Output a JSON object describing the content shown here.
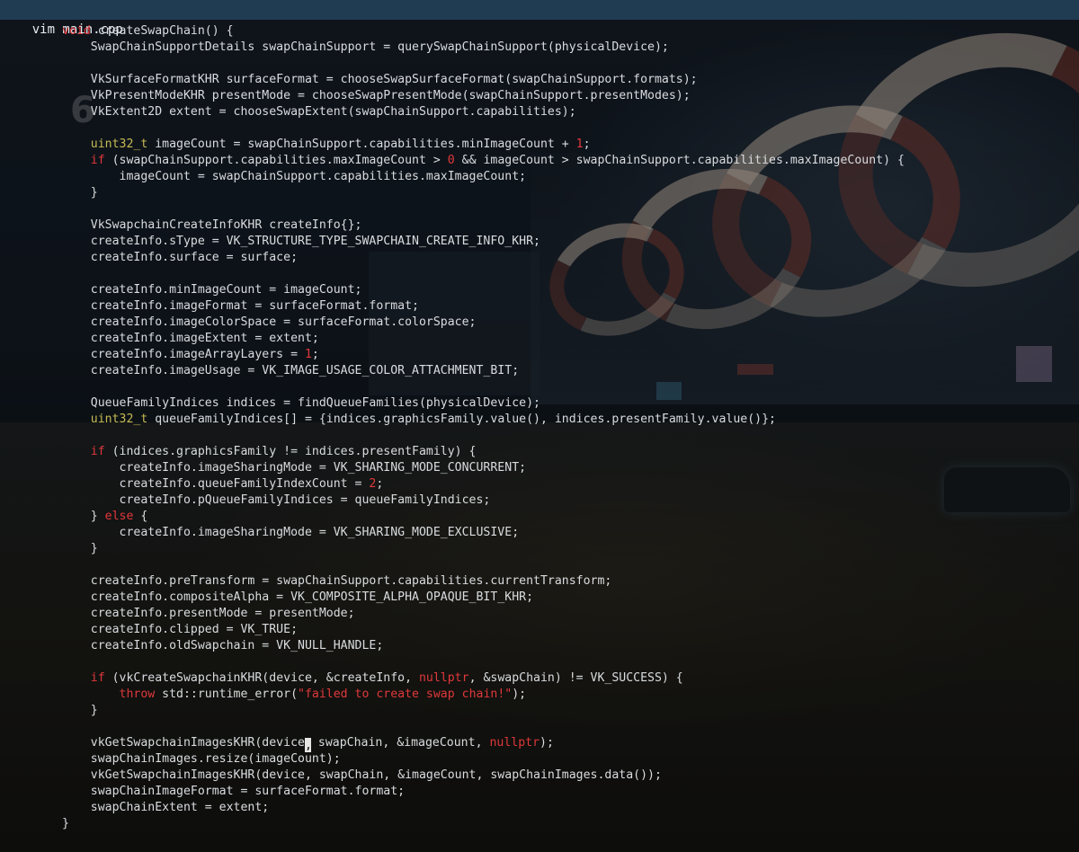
{
  "window": {
    "title": "vim main.cpp"
  },
  "editor": {
    "colors": {
      "keyword": "#e0383b",
      "type": "#c6bb53",
      "text": "#d9dcdf",
      "titlebar": "#203c53"
    },
    "lines": [
      [
        [
          "kw",
          "void"
        ],
        [
          "t",
          " createSwapChain() {"
        ]
      ],
      [
        [
          "t",
          "    SwapChainSupportDetails swapChainSupport = querySwapChainSupport(physicalDevice);"
        ]
      ],
      [],
      [
        [
          "t",
          "    VkSurfaceFormatKHR surfaceFormat = chooseSwapSurfaceFormat(swapChainSupport.formats);"
        ]
      ],
      [
        [
          "t",
          "    VkPresentModeKHR presentMode = chooseSwapPresentMode(swapChainSupport.presentModes);"
        ]
      ],
      [
        [
          "t",
          "    VkExtent2D extent = chooseSwapExtent(swapChainSupport.capabilities);"
        ]
      ],
      [],
      [
        [
          "ty",
          "    uint32_t"
        ],
        [
          "t",
          " imageCount = swapChainSupport.capabilities.minImageCount + "
        ],
        [
          "num",
          "1"
        ],
        [
          "t",
          ";"
        ]
      ],
      [
        [
          "kw",
          "    if"
        ],
        [
          "t",
          " (swapChainSupport.capabilities.maxImageCount > "
        ],
        [
          "num",
          "0"
        ],
        [
          "t",
          " && imageCount > swapChainSupport.capabilities.maxImageCount) {"
        ]
      ],
      [
        [
          "t",
          "        imageCount = swapChainSupport.capabilities.maxImageCount;"
        ]
      ],
      [
        [
          "t",
          "    }"
        ]
      ],
      [],
      [
        [
          "t",
          "    VkSwapchainCreateInfoKHR createInfo{};"
        ]
      ],
      [
        [
          "t",
          "    createInfo.sType = VK_STRUCTURE_TYPE_SWAPCHAIN_CREATE_INFO_KHR;"
        ]
      ],
      [
        [
          "t",
          "    createInfo.surface = surface;"
        ]
      ],
      [],
      [
        [
          "t",
          "    createInfo.minImageCount = imageCount;"
        ]
      ],
      [
        [
          "t",
          "    createInfo.imageFormat = surfaceFormat.format;"
        ]
      ],
      [
        [
          "t",
          "    createInfo.imageColorSpace = surfaceFormat.colorSpace;"
        ]
      ],
      [
        [
          "t",
          "    createInfo.imageExtent = extent;"
        ]
      ],
      [
        [
          "t",
          "    createInfo.imageArrayLayers = "
        ],
        [
          "num",
          "1"
        ],
        [
          "t",
          ";"
        ]
      ],
      [
        [
          "t",
          "    createInfo.imageUsage = VK_IMAGE_USAGE_COLOR_ATTACHMENT_BIT;"
        ]
      ],
      [],
      [
        [
          "t",
          "    QueueFamilyIndices indices = findQueueFamilies(physicalDevice);"
        ]
      ],
      [
        [
          "ty",
          "    uint32_t"
        ],
        [
          "t",
          " queueFamilyIndices[] = {indices.graphicsFamily.value(), indices.presentFamily.value()};"
        ]
      ],
      [],
      [
        [
          "kw",
          "    if"
        ],
        [
          "t",
          " (indices.graphicsFamily != indices.presentFamily) {"
        ]
      ],
      [
        [
          "t",
          "        createInfo.imageSharingMode = VK_SHARING_MODE_CONCURRENT;"
        ]
      ],
      [
        [
          "t",
          "        createInfo.queueFamilyIndexCount = "
        ],
        [
          "num",
          "2"
        ],
        [
          "t",
          ";"
        ]
      ],
      [
        [
          "t",
          "        createInfo.pQueueFamilyIndices = queueFamilyIndices;"
        ]
      ],
      [
        [
          "t",
          "    } "
        ],
        [
          "kw",
          "else"
        ],
        [
          "t",
          " {"
        ]
      ],
      [
        [
          "t",
          "        createInfo.imageSharingMode = VK_SHARING_MODE_EXCLUSIVE;"
        ]
      ],
      [
        [
          "t",
          "    }"
        ]
      ],
      [],
      [
        [
          "t",
          "    createInfo.preTransform = swapChainSupport.capabilities.currentTransform;"
        ]
      ],
      [
        [
          "t",
          "    createInfo.compositeAlpha = VK_COMPOSITE_ALPHA_OPAQUE_BIT_KHR;"
        ]
      ],
      [
        [
          "t",
          "    createInfo.presentMode = presentMode;"
        ]
      ],
      [
        [
          "t",
          "    createInfo.clipped = VK_TRUE;"
        ]
      ],
      [
        [
          "t",
          "    createInfo.oldSwapchain = VK_NULL_HANDLE;"
        ]
      ],
      [],
      [
        [
          "kw",
          "    if"
        ],
        [
          "t",
          " (vkCreateSwapchainKHR(device, &createInfo, "
        ],
        [
          "kw",
          "nullptr"
        ],
        [
          "t",
          ", &swapChain) != VK_SUCCESS) {"
        ]
      ],
      [
        [
          "kw",
          "        throw"
        ],
        [
          "t",
          " std::runtime_error("
        ],
        [
          "str",
          "\"failed to create swap chain!\""
        ],
        [
          "t",
          ");"
        ]
      ],
      [
        [
          "t",
          "    }"
        ]
      ],
      [],
      [
        [
          "t",
          "    vkGetSwapchainImagesKHR(device"
        ],
        [
          "cur",
          ","
        ],
        [
          "t",
          " swapChain, &imageCount, "
        ],
        [
          "kw",
          "nullptr"
        ],
        [
          "t",
          ");"
        ]
      ],
      [
        [
          "t",
          "    swapChainImages.resize(imageCount);"
        ]
      ],
      [
        [
          "t",
          "    vkGetSwapchainImagesKHR(device, swapChain, &imageCount, swapChainImages.data());"
        ]
      ],
      [
        [
          "t",
          "    swapChainImageFormat = surfaceFormat.format;"
        ]
      ],
      [
        [
          "t",
          "    swapChainExtent = extent;"
        ]
      ],
      [
        [
          "t",
          "}"
        ]
      ]
    ]
  }
}
